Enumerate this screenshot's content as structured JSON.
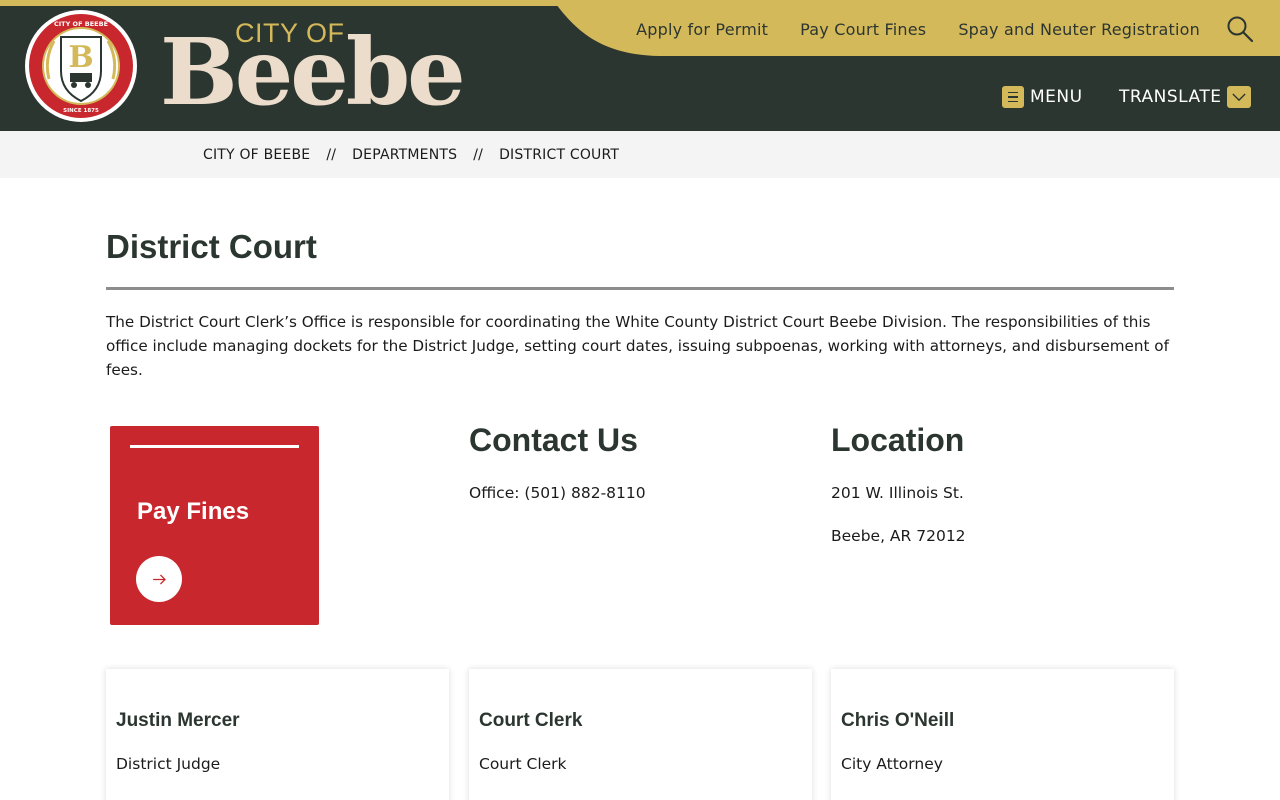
{
  "header": {
    "logo": {
      "seal_top_text": "CITY OF BEEBE",
      "seal_bottom_text": "SINCE 1875",
      "wordmark_small": "CITY OF",
      "wordmark_large": "Beebe"
    },
    "top_links": [
      "Apply for Permit",
      "Pay Court Fines",
      "Spay and Neuter Registration"
    ],
    "search_icon": "search-icon",
    "menu_label": "MENU",
    "translate_label": "TRANSLATE"
  },
  "colors": {
    "header_bg": "#2c3630",
    "gold": "#d4b95a",
    "wordmark": "#ebdccb",
    "accent_red": "#c8272d"
  },
  "breadcrumb": {
    "items": [
      "CITY OF BEEBE",
      "DEPARTMENTS",
      "DISTRICT COURT"
    ],
    "separator": "//"
  },
  "page": {
    "title": "District Court",
    "intro": "The District Court Clerk’s Office is responsible for coordinating the White County District Court Beebe Division. The responsibilities of this office include managing dockets for the District Judge, setting court dates, issuing subpoenas, working with attorneys, and disbursement of fees."
  },
  "pay_fines_card": {
    "label": "Pay Fines",
    "icon": "arrow-right-icon"
  },
  "contact": {
    "heading": "Contact Us",
    "office": "Office: (501) 882-8110"
  },
  "location": {
    "heading": "Location",
    "line1": "201 W. Illinois St.",
    "line2": "Beebe, AR 72012"
  },
  "staff": [
    {
      "name": "Justin Mercer",
      "role": "District Judge"
    },
    {
      "name": "Court Clerk",
      "role": "Court Clerk"
    },
    {
      "name": "Chris O'Neill",
      "role": "City Attorney"
    }
  ]
}
